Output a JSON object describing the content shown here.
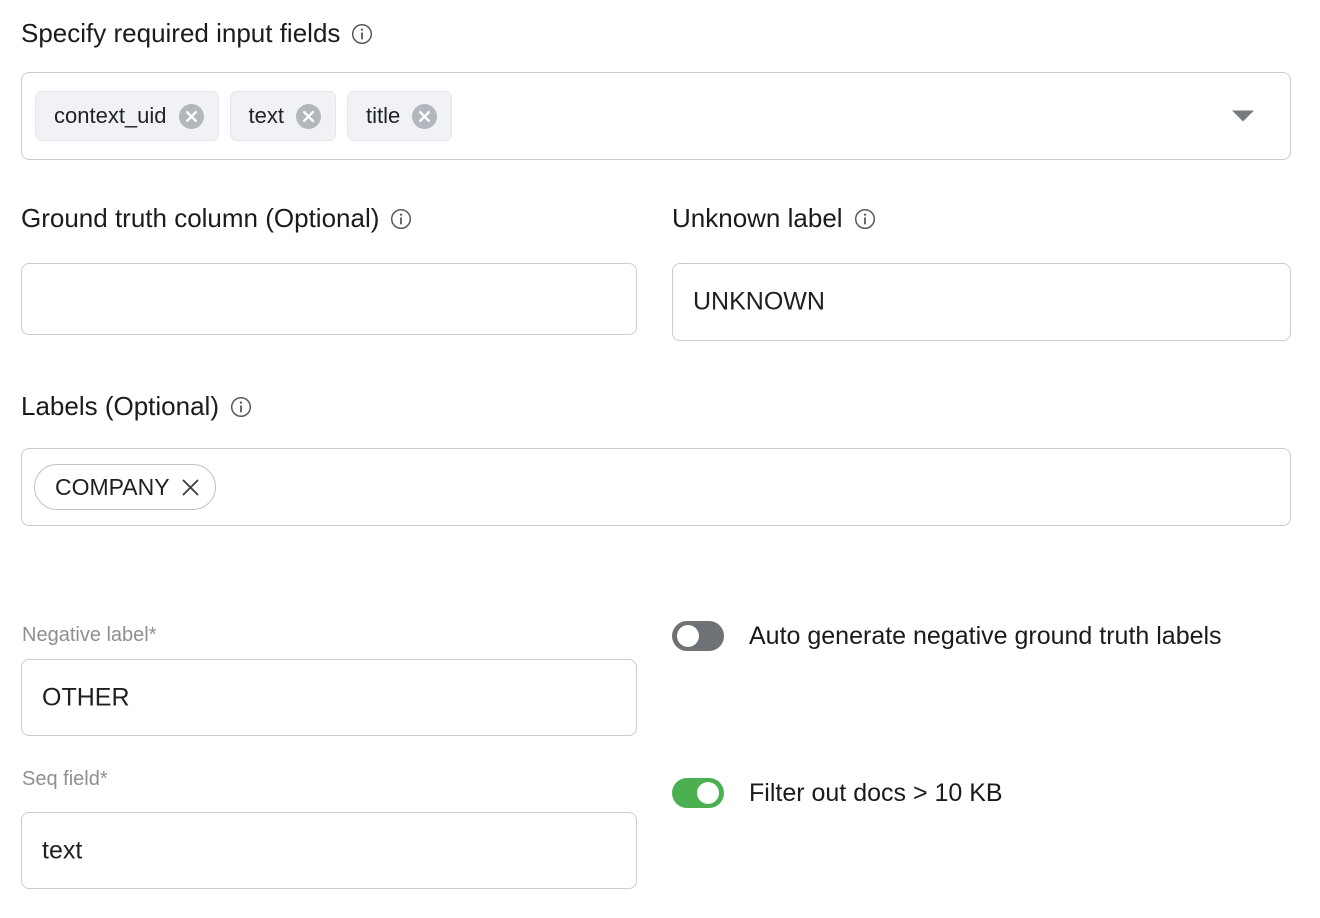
{
  "form": {
    "input_fields_section": {
      "heading": "Specify required input fields",
      "info_icon": "info-circle-icon",
      "chips": [
        {
          "label": "context_uid",
          "remove_icon": "remove-circle-icon"
        },
        {
          "label": "text",
          "remove_icon": "remove-circle-icon"
        },
        {
          "label": "title",
          "remove_icon": "remove-circle-icon"
        }
      ],
      "dropdown_icon": "caret-down-icon"
    },
    "ground_truth_column": {
      "heading": "Ground truth column (Optional)",
      "info_icon": "info-circle-icon",
      "value": "",
      "placeholder": ""
    },
    "unknown_label": {
      "heading": "Unknown label",
      "info_icon": "info-circle-icon",
      "value": "UNKNOWN",
      "placeholder": ""
    },
    "labels_section": {
      "heading": "Labels (Optional)",
      "info_icon": "info-circle-icon",
      "chips": [
        {
          "label": "COMPANY",
          "remove_icon": "close-x-icon"
        }
      ]
    },
    "negative_label": {
      "label": "Negative label*",
      "value": "OTHER",
      "placeholder": ""
    },
    "seq_field": {
      "label": "Seq field*",
      "value": "text",
      "placeholder": ""
    },
    "toggles": [
      {
        "label": "Auto generate negative ground truth labels",
        "state": "off",
        "color": "#6e7176"
      },
      {
        "label": "Filter out docs > 10 KB",
        "state": "on",
        "color": "#4caf50"
      }
    ]
  },
  "theme": {
    "background": "#ffffff",
    "border": "#c9ccd2",
    "text": "#1b1b1b",
    "muted_text": "#8d8f93",
    "chip_bg": "#f1f2f6",
    "toggle_on": "#4caf50",
    "toggle_off": "#6e7176"
  }
}
